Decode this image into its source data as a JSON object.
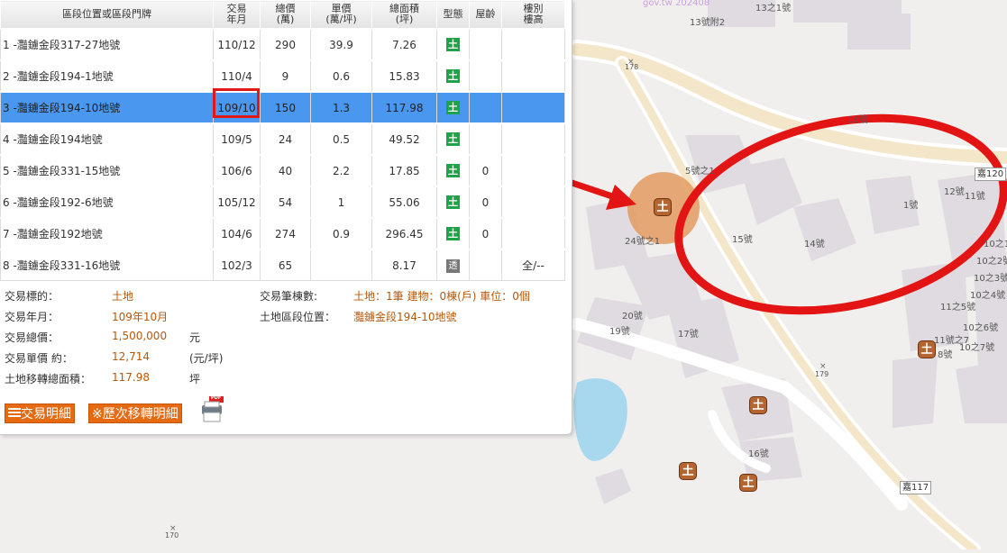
{
  "table": {
    "headers": {
      "location": "區段位置或區段門牌",
      "date_line1": "交易",
      "date_line2": "年月",
      "total_line1": "總價",
      "total_line2": "(萬)",
      "unit_line1": "單價",
      "unit_line2": "(萬/坪)",
      "area_line1": "總面積",
      "area_line2": "(坪)",
      "type": "型態",
      "age": "屋齡",
      "floor_line1": "樓別",
      "floor_line2": "樓高"
    },
    "rows": [
      {
        "addr": "1 -灩鐪金段317-27地號",
        "date": "110/12",
        "total": "290",
        "unit": "39.9",
        "area": "7.26",
        "type": "土",
        "age": "",
        "floor": ""
      },
      {
        "addr": "2 -灩鐪金段194-1地號",
        "date": "110/4",
        "total": "9",
        "unit": "0.6",
        "area": "15.83",
        "type": "土",
        "age": "",
        "floor": ""
      },
      {
        "addr": "3 -灩鐪金段194-10地號",
        "date": "109/10",
        "total": "150",
        "unit": "1.3",
        "area": "117.98",
        "type": "土",
        "age": "",
        "floor": ""
      },
      {
        "addr": "4 -灩鐪金段194地號",
        "date": "109/5",
        "total": "24",
        "unit": "0.5",
        "area": "49.52",
        "type": "土",
        "age": "",
        "floor": ""
      },
      {
        "addr": "5 -灩鐪金段331-15地號",
        "date": "106/6",
        "total": "40",
        "unit": "2.2",
        "area": "17.85",
        "type": "土",
        "age": "0",
        "floor": ""
      },
      {
        "addr": "6 -灩鐪金段192-6地號",
        "date": "105/12",
        "total": "54",
        "unit": "1",
        "area": "55.06",
        "type": "土",
        "age": "0",
        "floor": ""
      },
      {
        "addr": "7 -灩鐪金段192地號",
        "date": "104/6",
        "total": "274",
        "unit": "0.9",
        "area": "296.45",
        "type": "土",
        "age": "0",
        "floor": ""
      },
      {
        "addr": "8 -灩鐪金段331-16地號",
        "date": "102/3",
        "total": "65",
        "unit": "",
        "area": "8.17",
        "type": "透",
        "age": "",
        "floor": "全/--"
      }
    ]
  },
  "details": {
    "target_label": "交易標的：",
    "target_value": "土地",
    "date_label": "交易年月：",
    "date_value": "109年10月",
    "total_label": "交易總價：",
    "total_value": "1,500,000",
    "total_unit": "元",
    "unit_label": "交易單價 約：",
    "unit_value": "12,714",
    "unit_unit": "(元/坪)",
    "area_label": "土地移轉總面積：",
    "area_value": "117.98",
    "area_unit": "坪",
    "count_label": "交易筆棟數:",
    "count_value": "土地：1筆 建物：0棟(戶) 車位：0個",
    "location_label": "土地區段位置：",
    "location_value": "灩鐪金段194-10地號"
  },
  "buttons": {
    "detail": "交易明細",
    "history": "※歷次移轉明細",
    "pdf_badge": "PDF"
  },
  "map": {
    "watermark": "gov.tw 202408",
    "labels": [
      "13之1號",
      "13號附2",
      "178",
      "16號",
      "5號之1",
      "24號之1",
      "15號",
      "14號",
      "1號",
      "12號",
      "11號",
      "10之1",
      "10之2號",
      "10之3號",
      "10之4號",
      "11之5號",
      "10之6號",
      "11號之7",
      "10之7號",
      "8號",
      "20號",
      "19號",
      "17號",
      "179",
      "16號",
      "170"
    ],
    "roads": [
      "嘉120",
      "嘉117"
    ],
    "pin_glyph": "土"
  }
}
